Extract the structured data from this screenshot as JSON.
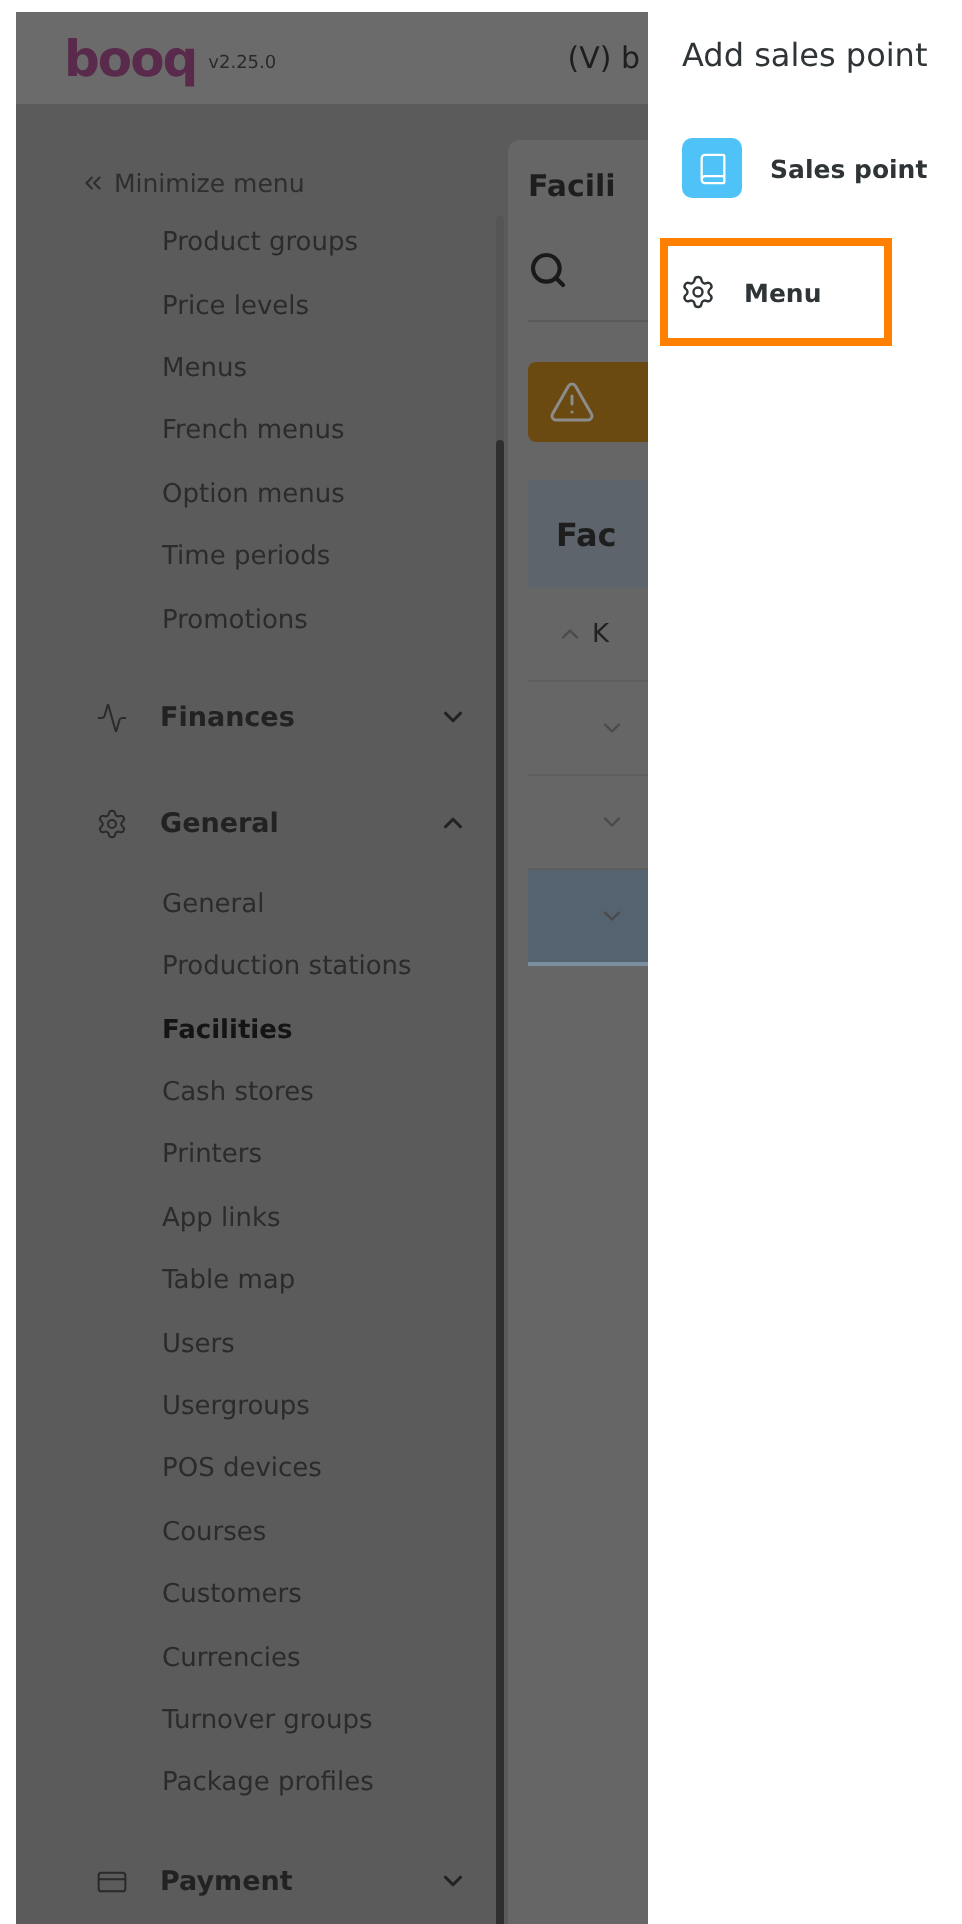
{
  "header": {
    "logo": "booq",
    "version": "v2.25.0",
    "title": "(V) b"
  },
  "sidebar": {
    "minimize": "Minimize menu",
    "items": [
      {
        "kind": "link",
        "label": "Product groups",
        "selected": false
      },
      {
        "kind": "link",
        "label": "Price levels",
        "selected": false
      },
      {
        "kind": "link",
        "label": "Menus",
        "selected": false
      },
      {
        "kind": "link",
        "label": "French menus",
        "selected": false
      },
      {
        "kind": "link",
        "label": "Option menus",
        "selected": false
      },
      {
        "kind": "link",
        "label": "Time periods",
        "selected": false
      },
      {
        "kind": "link",
        "label": "Promotions",
        "selected": false
      },
      {
        "kind": "section",
        "label": "Finances",
        "expanded": false
      },
      {
        "kind": "section",
        "label": "General",
        "expanded": true,
        "children": [
          {
            "label": "General",
            "selected": false
          },
          {
            "label": "Production stations",
            "selected": false
          },
          {
            "label": "Facilities",
            "selected": true
          },
          {
            "label": "Cash stores",
            "selected": false
          },
          {
            "label": "Printers",
            "selected": false
          },
          {
            "label": "App links",
            "selected": false
          },
          {
            "label": "Table map",
            "selected": false
          },
          {
            "label": "Users",
            "selected": false
          },
          {
            "label": "Usergroups",
            "selected": false
          },
          {
            "label": "POS devices",
            "selected": false
          },
          {
            "label": "Courses",
            "selected": false
          },
          {
            "label": "Customers",
            "selected": false
          },
          {
            "label": "Currencies",
            "selected": false
          },
          {
            "label": "Turnover groups",
            "selected": false
          },
          {
            "label": "Package profiles",
            "selected": false
          }
        ]
      },
      {
        "kind": "section",
        "label": "Payment",
        "expanded": false
      }
    ]
  },
  "content": {
    "title": "Facili",
    "panel_header": "Fac",
    "rows": [
      {
        "label": "K",
        "expanded": true,
        "selected": false
      },
      {
        "expanded": false,
        "selected": false
      },
      {
        "expanded": false,
        "selected": false
      },
      {
        "expanded": false,
        "selected": true
      }
    ]
  },
  "drawer": {
    "title": "Add sales point",
    "options": [
      {
        "kind": "sales-point",
        "label": "Sales point",
        "highlighted": false
      },
      {
        "kind": "menu",
        "label": "Menu",
        "highlighted": true
      }
    ]
  }
}
